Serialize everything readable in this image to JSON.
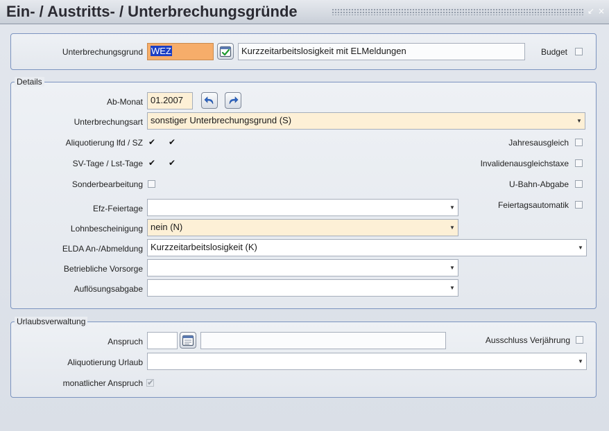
{
  "window": {
    "title": "Ein- / Austritts- / Unterbrechungsgründe",
    "minimize_glyph": "↙",
    "close_glyph": "×"
  },
  "header": {
    "unterbrechungsgrund_label": "Unterbrechungsgrund",
    "unterbrechungsgrund_code": "WEZ",
    "unterbrechungsgrund_text": "Kurzzeitarbeitslosigkeit mit ELMeldungen",
    "budget_label": "Budget",
    "budget_checked": false
  },
  "details": {
    "legend": "Details",
    "ab_monat_label": "Ab-Monat",
    "ab_monat_value": "01.2007",
    "unterbrechungsart_label": "Unterbrechungsart",
    "unterbrechungsart_value": "sonstiger Unterbrechungsgrund (S)",
    "aliquotierung_label": "Aliquotierung lfd / SZ",
    "aliquotierung_lfd": true,
    "aliquotierung_sz": true,
    "svtage_label": "SV-Tage / Lst-Tage",
    "svtage": true,
    "lsttage": true,
    "sonderbearbeitung_label": "Sonderbearbeitung",
    "sonderbearbeitung": false,
    "jahresausgleich_label": "Jahresausgleich",
    "jahresausgleich": false,
    "invaliden_label": "Invalidenausgleichstaxe",
    "invaliden": false,
    "ubahn_label": "U-Bahn-Abgabe",
    "ubahn": false,
    "feiertagsautomatik_label": "Feiertagsautomatik",
    "feiertagsautomatik": false,
    "efz_label": "Efz-Feiertage",
    "efz_value": "",
    "lohnbescheinigung_label": "Lohnbescheinigung",
    "lohnbescheinigung_value": "nein (N)",
    "elda_label": "ELDA An-/Abmeldung",
    "elda_value": "Kurzzeitarbeitslosigkeit (K)",
    "vorsorge_label": "Betriebliche Vorsorge",
    "vorsorge_value": "",
    "aufloesung_label": "Auflösungsabgabe",
    "aufloesung_value": ""
  },
  "urlaub": {
    "legend": "Urlaubsverwaltung",
    "anspruch_label": "Anspruch",
    "anspruch_value": "",
    "anspruch_text": "",
    "ausschluss_label": "Ausschluss Verjährung",
    "ausschluss": false,
    "aliquotierung_urlaub_label": "Aliquotierung Urlaub",
    "aliquotierung_urlaub_value": "",
    "monatlich_label": "monatlicher Anspruch",
    "monatlich": true
  },
  "icons": {
    "check_glyph": "✔",
    "dropdown_glyph": "▼"
  },
  "colors": {
    "required_bg": "#fdf0d6",
    "selected_code_bg": "#f6ad6a",
    "panel_border": "#7b93bf"
  }
}
